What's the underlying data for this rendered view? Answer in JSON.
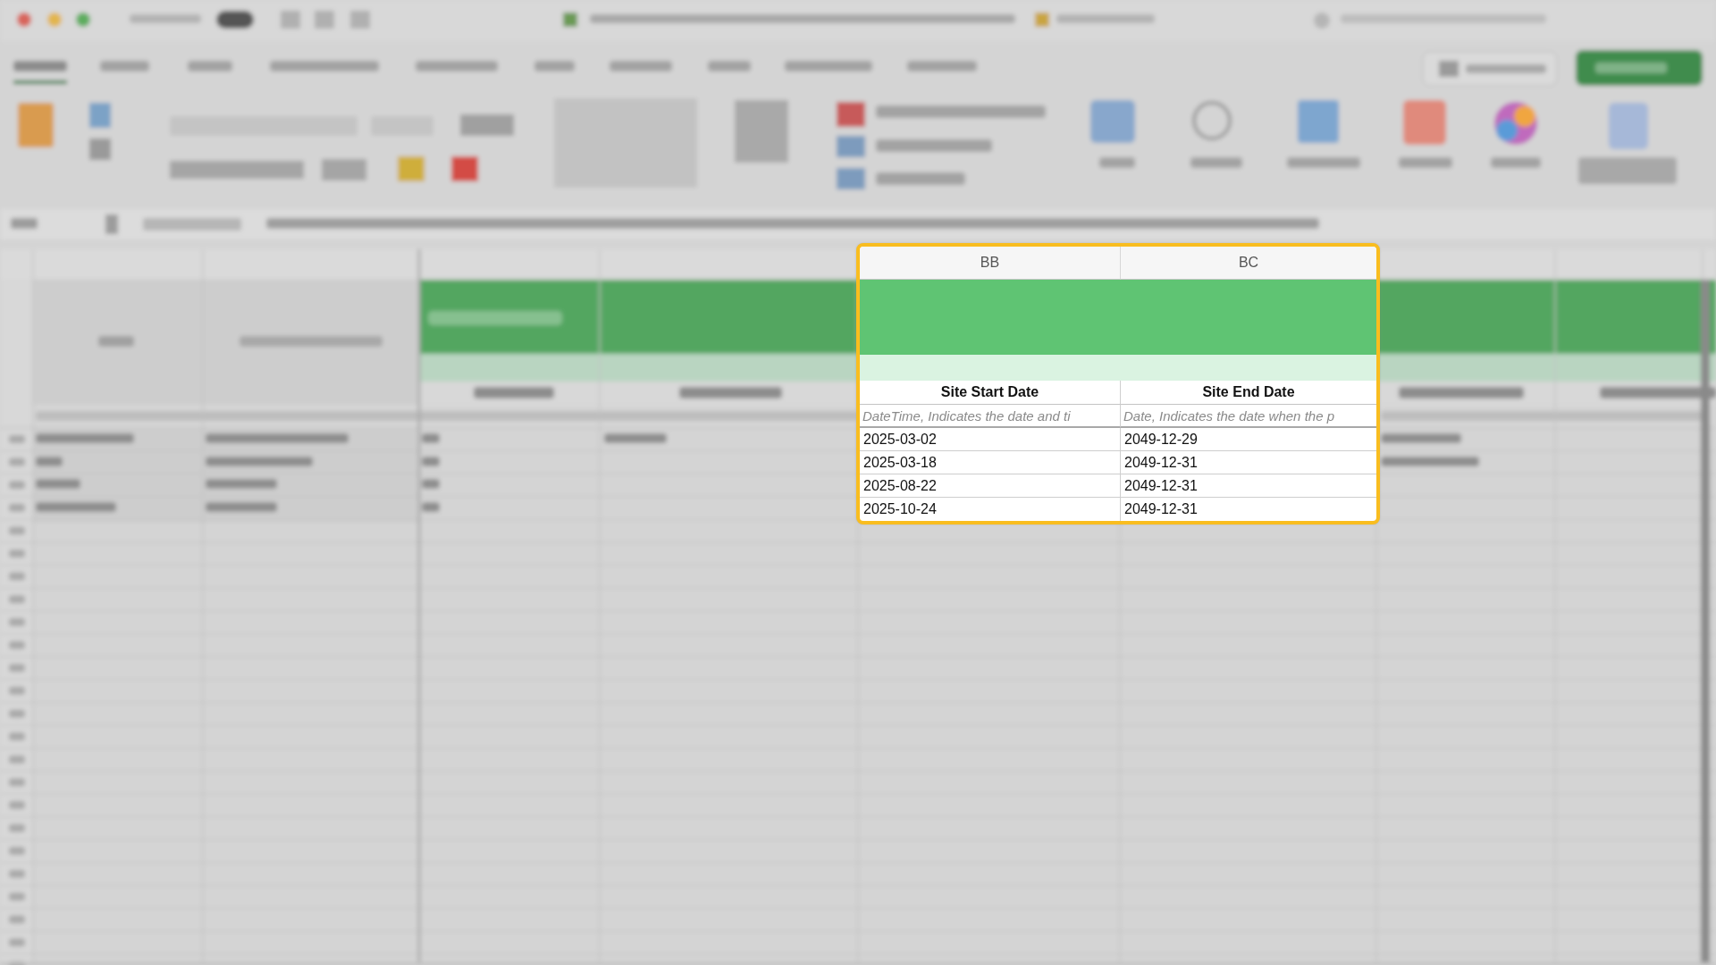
{
  "focus_panel": {
    "columns": [
      {
        "letter": "BB",
        "heading": "Site Start Date",
        "description": "DateTime, Indicates the date and ti"
      },
      {
        "letter": "BC",
        "heading": "Site End Date",
        "description": "Date, Indicates the date when the p"
      }
    ],
    "rows": [
      [
        "2025-03-02",
        "2049-12-29"
      ],
      [
        "2025-03-18",
        "2049-12-31"
      ],
      [
        "2025-08-22",
        "2049-12-31"
      ],
      [
        "2025-10-24",
        "2049-12-31"
      ]
    ]
  }
}
